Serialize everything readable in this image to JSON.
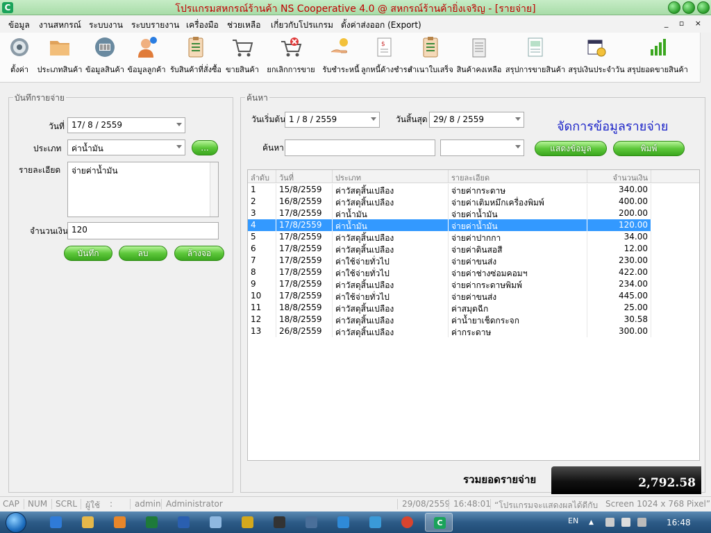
{
  "window": {
    "title": "โปรแกรมสหกรณ์ร้านค้า NS Cooperative 4.0 @ สหกรณ์ร้านค้ายิ่งเจริญ - [รายจ่าย]",
    "app_icon_letter": "C"
  },
  "menu": [
    "ข้อมูล",
    "งานสหกรณ์",
    "ระบบงาน",
    "ระบบรายงาน",
    "เครื่องมือ",
    "ช่วยเหลือ",
    "เกี่ยวกับโปรแกรม",
    "ตั้งค่าส่งออก (Export)"
  ],
  "mdi_controls": "_ ▫ ×",
  "toolbar": [
    {
      "label": "ตั้งค่า",
      "icon": "gear-icon"
    },
    {
      "label": "ประเภทสินค้า",
      "icon": "folder-icon"
    },
    {
      "label": "ข้อมูลสินค้า",
      "icon": "barcode-scanner-icon"
    },
    {
      "label": "ข้อมูลลูกค้า",
      "icon": "customer-icon"
    },
    {
      "label": "รับสินค้าที่สั่งซื้อ",
      "icon": "clipboard-icon"
    },
    {
      "label": "ขายสินค้า",
      "icon": "cart-icon"
    },
    {
      "label": "ยกเลิกการขาย",
      "icon": "cart-cancel-icon"
    },
    {
      "label": "รับชำระหนี้",
      "icon": "payment-hand-icon"
    },
    {
      "label": "ลูกหนี้ค้างชำระ",
      "icon": "invoice-icon"
    },
    {
      "label": "สำเนาใบเสร็จ",
      "icon": "receipt-copy-icon"
    },
    {
      "label": "สินค้าคงเหลือ",
      "icon": "inventory-icon"
    },
    {
      "label": "สรุปการขายสินค้า",
      "icon": "sales-summary-icon"
    },
    {
      "label": "สรุปเงินประจำวัน",
      "icon": "calendar-clock-icon"
    },
    {
      "label": "สรุปยอดขายสินค้า",
      "icon": "bar-chart-icon"
    }
  ],
  "entry": {
    "group_title": "บันทึกรายจ่าย",
    "date_label": "วันที่",
    "date_value": "17/ 8 / 2559",
    "type_label": "ประเภท",
    "type_value": "ค่าน้ำมัน",
    "browse_label": "...",
    "detail_label": "รายละเอียด",
    "detail_value": "จ่ายค่าน้ำมัน",
    "amount_label": "จำนวนเงิน",
    "amount_value": "120",
    "save_label": "บันทึก",
    "delete_label": "ลบ",
    "clear_label": "ล้างจอ"
  },
  "search": {
    "group_title": "ค้นหา",
    "start_label": "วันเริ่มต้น",
    "start_value": "1 / 8 / 2559",
    "end_label": "วันสิ้นสุด",
    "end_value": "29/ 8 / 2559",
    "keyword_label": "ค้นหา",
    "keyword_value": "",
    "filter_value": "",
    "show_label": "แสดงข้อมูล",
    "print_label": "พิมพ์",
    "heading": "จัดการข้อมูลรายจ่าย"
  },
  "table": {
    "headers": [
      "ลำดับ",
      "วันที่",
      "ประเภท",
      "รายละเอียด",
      "จำนวนเงิน"
    ],
    "selected_index": 3,
    "rows": [
      [
        "1",
        "15/8/2559",
        "ค่าวัสดุสิ้นเปลือง",
        "จ่ายค่ากระดาษ",
        "340.00"
      ],
      [
        "2",
        "16/8/2559",
        "ค่าวัสดุสิ้นเปลือง",
        "จ่ายค่าเติมหมึกเครื่องพิมพ์",
        "400.00"
      ],
      [
        "3",
        "17/8/2559",
        "ค่าน้ำมัน",
        "จ่ายค่าน้ำมัน",
        "200.00"
      ],
      [
        "4",
        "17/8/2559",
        "ค่าน้ำมัน",
        "จ่ายค่าน้ำมัน",
        "120.00"
      ],
      [
        "5",
        "17/8/2559",
        "ค่าวัสดุสิ้นเปลือง",
        "จ่ายค่าปากกา",
        "34.00"
      ],
      [
        "6",
        "17/8/2559",
        "ค่าวัสดุสิ้นเปลือง",
        "จ่ายค่าดินสอสี",
        "12.00"
      ],
      [
        "7",
        "17/8/2559",
        "ค่าใช้จ่ายทั่วไป",
        "จ่ายค่าขนส่ง",
        "230.00"
      ],
      [
        "8",
        "17/8/2559",
        "ค่าใช้จ่ายทั่วไป",
        "จ่ายค่าช่างซ่อมคอมฯ",
        "422.00"
      ],
      [
        "9",
        "17/8/2559",
        "ค่าวัสดุสิ้นเปลือง",
        "จ่ายค่ากระดาษพิมพ์",
        "234.00"
      ],
      [
        "10",
        "17/8/2559",
        "ค่าใช้จ่ายทั่วไป",
        "จ่ายค่าขนส่ง",
        "445.00"
      ],
      [
        "11",
        "18/8/2559",
        "ค่าวัสดุสิ้นเปลือง",
        "ค่าสมุดฉีก",
        "25.00"
      ],
      [
        "12",
        "18/8/2559",
        "ค่าวัสดุสิ้นเปลือง",
        "ค่าน้ำยาเช็ดกระจก",
        "30.58"
      ],
      [
        "13",
        "26/8/2559",
        "ค่าวัสดุสิ้นเปลือง",
        "ค่ากระดาษ",
        "300.00"
      ]
    ]
  },
  "total": {
    "label": "รวมยอดรายจ่าย",
    "value": "2,792.58"
  },
  "statusbar": {
    "cap": "CAP",
    "num": "NUM",
    "scrl": "SCRL",
    "user_label": "ผู้ใช้",
    "colon": ":",
    "username": "admin",
    "role": "Administrator",
    "date": "29/08/2559",
    "time": "16:48:01",
    "hint": "“โปรแกรมจะแสดงผลได้ดีกับ",
    "screen": "Screen 1024 x 768 Pixel”"
  },
  "taskbar": {
    "lang": "EN",
    "clock": "16:48"
  },
  "colors": {
    "accent_green": "#3aa61e",
    "selection": "#3399ff",
    "heading_blue": "#1a22c8",
    "title_red": "#c00000"
  }
}
